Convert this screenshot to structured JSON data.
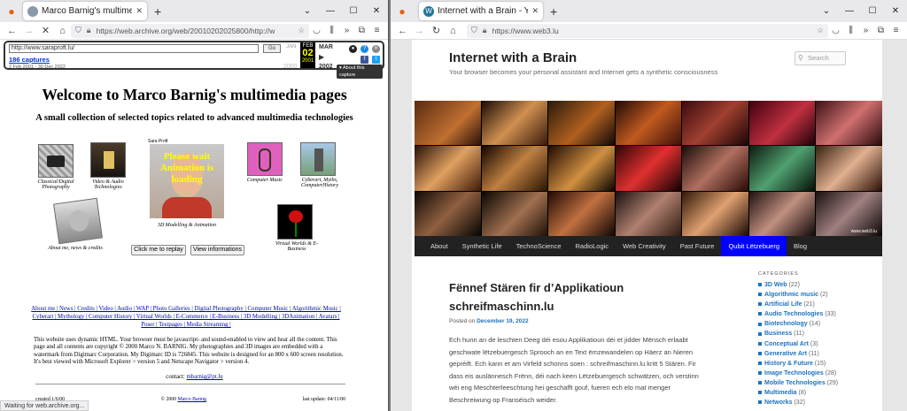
{
  "left": {
    "tab_title": "Marco Barnig's multimedia pag",
    "url": "https://web.archive.org/web/20010202025800/http://w",
    "wayback": {
      "input": "http://www.saraproft.lu/",
      "go": "Go",
      "captures": "186 captures",
      "dates": "2 Feb 2001 - 30 Dec 2022",
      "prev_month": "JAN",
      "cur_month": "FEB",
      "cur_day": "02",
      "cur_year": "2001",
      "next_month": "MAR",
      "prev_year": "2000",
      "next_year": "2002",
      "about": "▾ About this capture"
    },
    "title": "Welcome to Marco Barnig's multimedia pages",
    "subtitle": "A small collection of selected topics related to advanced multimedia technologies",
    "tiles": {
      "t1": "Classical/Digital Photography",
      "t2": "Video & Audio Technologies",
      "t3_top": "Sara Proft",
      "t3_overlay": "Please wait Animation is loading",
      "t3": "3D Modelling & Animation",
      "t4": "Computer Music",
      "t5": "Cyberart, Myths, ComputerHistory",
      "t6": "About me, news & credits",
      "t7": "Virtual Worlds & E-Business"
    },
    "btn_replay": "Click me to replay",
    "btn_info": "View informations",
    "links_html_text": "About me | News | Credits | Video | Audio | WAP | Photo Galleries | Digital Photography | Computer Music | Algorithmic Music | Cyberart | Mythology | Computer History | Virtual Worlds | E-Commerce | E-Business | 3D Modelling | 3DAnimation | Avatars | Poser | Testpages | Media Streaming |",
    "desc": "This website uses dynamic HTML. Your browser must be javascript- and sound-enabled to view and hear all the content. This page and all contents are copyright © 2000 Marco N. BARNIG. My photographies and 3D images are embedded with a watermark from Digimarc Corporation. My Digimarc ID is 726845. This website is designed for an 800 x 600 screen resolution. It's best viewed with Microsoft Explorer > version 5 and Netscape Navigator > version 4.",
    "contact_label": "contact: ",
    "contact_link": "mbarnig@pt.lu",
    "created": "created 1/6/00",
    "copyright_prefix": "© 2000 ",
    "copyright_link": "Marco Barnig",
    "updated": "last update: 04/11/00",
    "status": "Waiting for web.archive.org..."
  },
  "right": {
    "tab_title": "Internet with a Brain - Your bro",
    "url": "https://www.web3.lu",
    "site_title": "Internet with a Brain",
    "site_desc": "Your browser becomes your personal assistant and Internet gets a synthetic consciousness",
    "search_placeholder": "Search",
    "credit": "www.web3.lu",
    "menu": [
      "About",
      "Synthetic Life",
      "TechnoScience",
      "RadioLogic",
      "Web Creativity",
      "Past Future",
      "Qubit Lëtzebuerg",
      "Blog"
    ],
    "post_title": "Fënnef Stären fir d’Applikatioun schreifmaschinn.lu",
    "posted_on": "Posted on ",
    "post_date": "December 19, 2022",
    "post_body": "Ech hunn an de leschten Deeg déi esou Applikatioun déi et jidder Mënsch erlaabt geschwate lëtzebuergesch Sprooch an en Text ëmzewandelen op Häerz an Nieren gepréift. Ech kann et am Virfeld schonns soen : schreifmaschinn.lu kritt 5 Stären. Fir dass eis auslännesch Frënn, déi nach keen Lëtzebuergesch schwätzen, och verstinn wéi eng Meschterleeschtung hei geschafft gouf, fueren ech elo mat menger Beschreiwung op Franséisch weider.",
    "categories_header": "CATEGORIES",
    "categories": [
      {
        "name": "3D Web",
        "count": "(22)"
      },
      {
        "name": "Algorithmic music",
        "count": "(2)"
      },
      {
        "name": "Artificial Life",
        "count": "(21)"
      },
      {
        "name": "Audio Technologies",
        "count": "(33)"
      },
      {
        "name": "Biotechnology",
        "count": "(14)"
      },
      {
        "name": "Business",
        "count": "(11)"
      },
      {
        "name": "Conceptual Art",
        "count": "(3)"
      },
      {
        "name": "Generative Art",
        "count": "(11)"
      },
      {
        "name": "History & Future",
        "count": "(15)"
      },
      {
        "name": "Image Technologies",
        "count": "(28)"
      },
      {
        "name": "Mobile Technologies",
        "count": "(29)"
      },
      {
        "name": "Multimedia",
        "count": "(8)"
      },
      {
        "name": "Networks",
        "count": "(32)"
      }
    ]
  },
  "colors": {
    "accent": "#1e73be",
    "menu_active": "#0000ff",
    "link": "#0000cc"
  }
}
